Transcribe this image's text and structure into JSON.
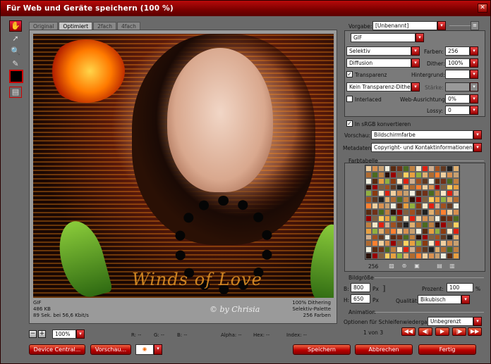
{
  "window": {
    "title": "Für Web und Geräte speichern (100 %)"
  },
  "tabs": [
    "Original",
    "Optimiert",
    "2fach",
    "4fach"
  ],
  "image": {
    "watermark": "Winds of Love",
    "signature": "© by Chrisia"
  },
  "preview_info": {
    "left": [
      "GIF",
      "486 KB",
      "89 Sek. bei 56,6 Kbit/s"
    ],
    "right": [
      "100% Dithering",
      "Selektiv-Palette",
      "256 Farben"
    ]
  },
  "zoom": {
    "value": "100%"
  },
  "status": {
    "r": "R: --",
    "g": "G: --",
    "b": "B: --",
    "alpha": "Alpha: --",
    "hex": "Hex: --",
    "index": "Index: --"
  },
  "bottom_buttons": {
    "device_central": "Device Central...",
    "preview": "Vorschau...",
    "save": "Speichern",
    "cancel": "Abbrechen",
    "done": "Fertig"
  },
  "settings": {
    "preset_label": "Vorgabe:",
    "preset_value": "[Unbenannt]",
    "format": "GIF",
    "reduction": "Selektiv",
    "colors_label": "Farben:",
    "colors_value": "256",
    "dither_algo": "Diffusion",
    "dither_label": "Dither:",
    "dither_value": "100%",
    "transparency_label": "Transparenz",
    "matte_label": "Hintergrund:",
    "transp_dither": "Kein Transparenz-Dither",
    "strength_label": "Stärke:",
    "interlaced_label": "Interlaced",
    "web_snap_label": "Web-Ausrichtung:",
    "web_snap_value": "0%",
    "lossy_label": "Lossy:",
    "lossy_value": "0",
    "srgb_label": "In sRGB konvertieren",
    "preview_label": "Vorschau:",
    "preview_value": "Bildschirmfarbe",
    "metadata_label": "Metadaten:",
    "metadata_value": "Copyright- und Kontaktinformationen"
  },
  "color_table": {
    "title": "Farbtabelle",
    "count": "256"
  },
  "image_size": {
    "title": "Bildgröße",
    "w_label": "B:",
    "w_value": "800",
    "h_label": "H:",
    "h_value": "650",
    "unit": "Px",
    "percent_label": "Prozent:",
    "percent_value": "100",
    "percent_unit": "%",
    "quality_label": "Qualität:",
    "quality_value": "Bikubisch"
  },
  "animation": {
    "title": "Animation",
    "loop_label": "Optionen für Schleifenwiedergabe:",
    "loop_value": "Unbegrenzt",
    "frame": "1 von 3"
  }
}
